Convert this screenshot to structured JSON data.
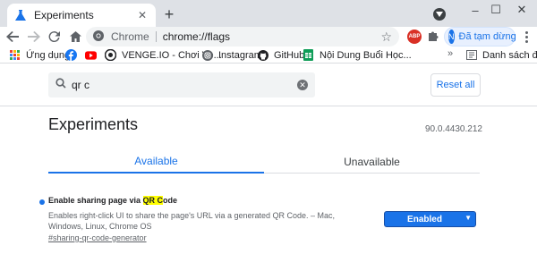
{
  "colors": {
    "accent": "#1a73e8",
    "highlight": "#ffff00",
    "tabstrip": "#dee1e6"
  },
  "tab": {
    "title": "Experiments",
    "icon": "flask-icon"
  },
  "window_controls": {
    "minimize": "–",
    "maximize": "☐",
    "close": "✕"
  },
  "toolbar": {
    "site_label": "Chrome",
    "url": "chrome://flags",
    "profile_initial": "N",
    "profile_label": "Đã tạm dừng",
    "extension_abp": "ABP"
  },
  "bookmarks": {
    "items": [
      {
        "label": "Ứng dụng",
        "icon": "apps-grid-icon"
      },
      {
        "label": "",
        "icon": "facebook-icon"
      },
      {
        "label": "",
        "icon": "youtube-icon"
      },
      {
        "label": "VENGE.IO - Chơi Ve...",
        "icon": "venge-icon"
      },
      {
        "label": "Instagram",
        "icon": "instagram-icon"
      },
      {
        "label": "GitHub",
        "icon": "github-icon"
      },
      {
        "label": "Nội Dung Buổi Học...",
        "icon": "sheets-icon"
      }
    ],
    "more": "»",
    "reading_list": "Danh sách đọc"
  },
  "search": {
    "value": "qr c",
    "reset_label": "Reset all"
  },
  "page": {
    "title": "Experiments",
    "version": "90.0.4430.212",
    "tabs": [
      {
        "label": "Available",
        "active": true
      },
      {
        "label": "Unavailable",
        "active": false
      }
    ]
  },
  "flag": {
    "title_pre": "Enable sharing page via ",
    "title_hl1": "QR C",
    "title_post": "ode",
    "desc_pre": "Enables right-click UI to share the page's URL via a generated QR Code. – Mac, Windows, Linux, Chrome OS",
    "link": "#sharing-qr-code-generator",
    "value": "Enabled"
  }
}
